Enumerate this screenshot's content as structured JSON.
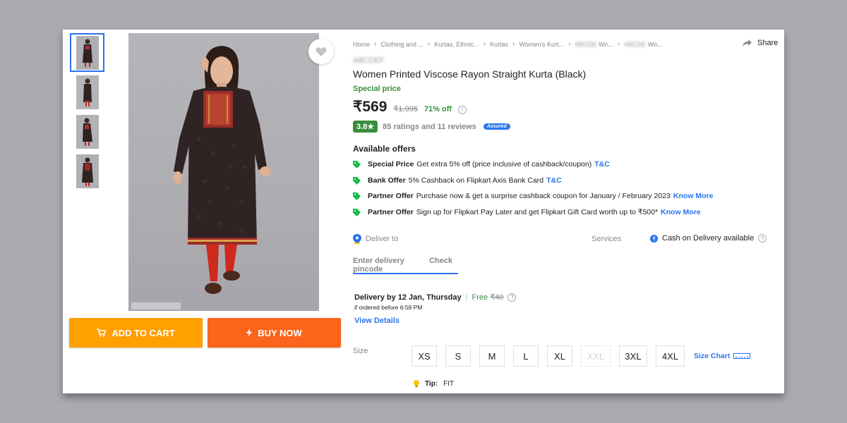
{
  "breadcrumbs": [
    "Home",
    "Clothing and ...",
    "Kurtas, Ethnic...",
    "Kurtas",
    "Women's Kurt...",
    "Wo...",
    "Wo..."
  ],
  "share_label": "Share",
  "brand": "",
  "title": "Women Printed Viscose Rayon Straight Kurta  (Black)",
  "special_price_label": "Special price",
  "price": "₹569",
  "mrp": "₹1,995",
  "discount": "71% off",
  "rating": "3.8★",
  "ratings_reviews": "85 ratings and 11 reviews",
  "assured_label": "Assured",
  "offers_heading": "Available offers",
  "offers": [
    {
      "type": "Special Price",
      "text": "Get extra 5% off (price inclusive of cashback/coupon)",
      "link": "T&C"
    },
    {
      "type": "Bank Offer",
      "text": "5% Cashback on Flipkart Axis Bank Card",
      "link": "T&C"
    },
    {
      "type": "Partner Offer",
      "text": "Purchase now & get a surprise cashback coupon for January / February 2023",
      "link": "Know More"
    },
    {
      "type": "Partner Offer",
      "text": "Sign up for Flipkart Pay Later and get Flipkart Gift Card worth up to ₹500*",
      "link": "Know More"
    }
  ],
  "deliver_to_label": "Deliver to",
  "services_label": "Services",
  "cod_label": "Cash on Delivery available",
  "pincode_placeholder": "Enter delivery pincode",
  "check_label": "Check",
  "delivery_date": "Delivery by 12 Jan, Thursday",
  "delivery_sep": "|",
  "free_label": "Free",
  "delivery_charge": "₹40",
  "ordered_before": "if ordered before 6:59 PM",
  "view_details": "View Details",
  "size_label": "Size",
  "sizes": [
    {
      "label": "XS",
      "available": true
    },
    {
      "label": "S",
      "available": true
    },
    {
      "label": "M",
      "available": true
    },
    {
      "label": "L",
      "available": true
    },
    {
      "label": "XL",
      "available": true
    },
    {
      "label": "XXL",
      "available": false
    },
    {
      "label": "3XL",
      "available": true
    },
    {
      "label": "4XL",
      "available": true
    }
  ],
  "size_chart_label": "Size Chart",
  "tip_label": "Tip:",
  "tip_value": "FIT",
  "add_to_cart": "ADD TO CART",
  "buy_now": "BUY NOW",
  "colors": {
    "accent": "#2874f0",
    "green": "#388e3c",
    "cart": "#ff9f00",
    "buy": "#fb641b",
    "background": "#acaab0"
  }
}
